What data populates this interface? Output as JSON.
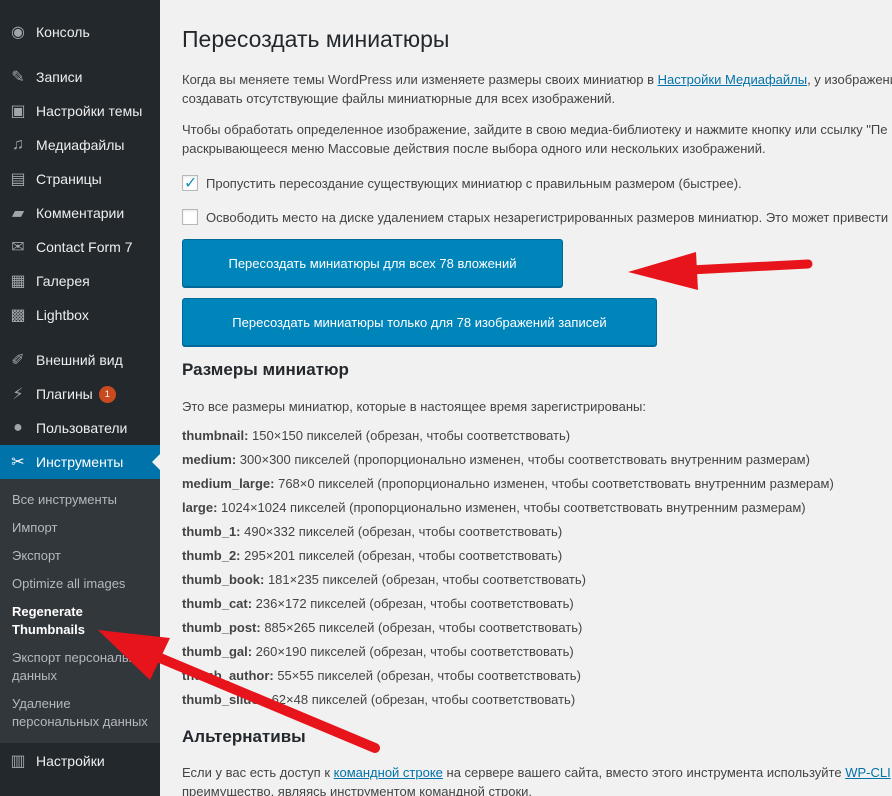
{
  "sidebar": {
    "items": [
      {
        "label": "Консоль",
        "icon": "dashboard-icon",
        "glyph": "◉"
      },
      {
        "label": "Записи",
        "icon": "pin-icon",
        "glyph": "✎"
      },
      {
        "label": "Настройки темы",
        "icon": "theme-settings-icon",
        "glyph": "▣"
      },
      {
        "label": "Медиафайлы",
        "icon": "media-icon",
        "glyph": "♫"
      },
      {
        "label": "Страницы",
        "icon": "pages-icon",
        "glyph": "▤"
      },
      {
        "label": "Комментарии",
        "icon": "comments-icon",
        "glyph": "▰"
      },
      {
        "label": "Contact Form 7",
        "icon": "mail-icon",
        "glyph": "✉"
      },
      {
        "label": "Галерея",
        "icon": "gallery-icon",
        "glyph": "▦"
      },
      {
        "label": "Lightbox",
        "icon": "lightbox-icon",
        "glyph": "▩"
      },
      {
        "label": "Внешний вид",
        "icon": "appearance-icon",
        "glyph": "✐"
      },
      {
        "label": "Плагины",
        "icon": "plugins-icon",
        "glyph": "⚡",
        "badge": "1"
      },
      {
        "label": "Пользователи",
        "icon": "users-icon",
        "glyph": "●"
      },
      {
        "label": "Инструменты",
        "icon": "wrench-icon",
        "glyph": "✂",
        "active": true
      },
      {
        "label": "Настройки",
        "icon": "settings-icon",
        "glyph": "▥"
      }
    ],
    "submenu": [
      {
        "label": "Все инструменты"
      },
      {
        "label": "Импорт"
      },
      {
        "label": "Экспорт"
      },
      {
        "label": "Optimize all images"
      },
      {
        "label": "Regenerate Thumbnails",
        "current": true
      },
      {
        "label": "Экспорт персональных данных"
      },
      {
        "label": "Удаление персональных данных"
      }
    ]
  },
  "main": {
    "title": "Пересоздать миниатюры",
    "intro": {
      "before": "Когда вы меняете темы WordPress или изменяете размеры своих миниатюр в ",
      "link": "Настройки Медиафайлы",
      "after": ", у изображений",
      "line2": "создавать отсутствующие файлы миниатюрные для всех изображений."
    },
    "info": {
      "line1": "Чтобы обработать определенное изображение, зайдите в свою медиа-библиотеку и нажмите кнопку или ссылку \"Пе",
      "line2": "раскрывающееся меню Массовые действия после выбора одного или нескольких изображений."
    },
    "options": [
      {
        "label": "Пропустить пересоздание существующих миниатюр с правильным размером (быстрее).",
        "checked": true
      },
      {
        "label": "Освободить место на диске удалением старых незарегистрированных размеров миниатюр. Это может привести к",
        "checked": false
      }
    ],
    "buttons": {
      "all": "Пересоздать миниатюры для всех 78 вложений",
      "featured": "Пересоздать миниатюры только для 78 изображений записей"
    },
    "sizes_heading": "Размеры миниатюр",
    "sizes_intro": "Это все размеры миниатюр, которые в настоящее время зарегистрированы:",
    "sizes": [
      {
        "name": "thumbnail:",
        "desc": " 150×150 пикселей (обрезан, чтобы соответствовать)"
      },
      {
        "name": "medium:",
        "desc": " 300×300 пикселей (пропорционально изменен, чтобы соответствовать внутренним размерам)"
      },
      {
        "name": "medium_large:",
        "desc": " 768×0 пикселей (пропорционально изменен, чтобы соответствовать внутренним размерам)"
      },
      {
        "name": "large:",
        "desc": " 1024×1024 пикселей (пропорционально изменен, чтобы соответствовать внутренним размерам)"
      },
      {
        "name": "thumb_1:",
        "desc": " 490×332 пикселей (обрезан, чтобы соответствовать)"
      },
      {
        "name": "thumb_2:",
        "desc": " 295×201 пикселей (обрезан, чтобы соответствовать)"
      },
      {
        "name": "thumb_book:",
        "desc": " 181×235 пикселей (обрезан, чтобы соответствовать)"
      },
      {
        "name": "thumb_cat:",
        "desc": " 236×172 пикселей (обрезан, чтобы соответствовать)"
      },
      {
        "name": "thumb_post:",
        "desc": " 885×265 пикселей (обрезан, чтобы соответствовать)"
      },
      {
        "name": "thumb_gal:",
        "desc": " 260×190 пикселей (обрезан, чтобы соответствовать)"
      },
      {
        "name": "thumb_author:",
        "desc": " 55×55 пикселей (обрезан, чтобы соответствовать)"
      },
      {
        "name": "thumb_slider:",
        "desc": " 62×48 пикселей (обрезан, чтобы соответствовать)"
      }
    ],
    "alt_heading": "Альтернативы",
    "alt": {
      "before": "Если у вас есть доступ к ",
      "link1": "командной строке",
      "middle": " на сервере вашего сайта, вместо этого инструмента используйте ",
      "link2": "WP-CLI",
      "line2": "преимущество, являясь инструментом командной строки."
    }
  },
  "colors": {
    "sidebar_bg": "#23282d",
    "submenu_bg": "#32373c",
    "accent": "#0073aa",
    "button": "#0085ba",
    "annotation_arrow": "#e8141b"
  }
}
